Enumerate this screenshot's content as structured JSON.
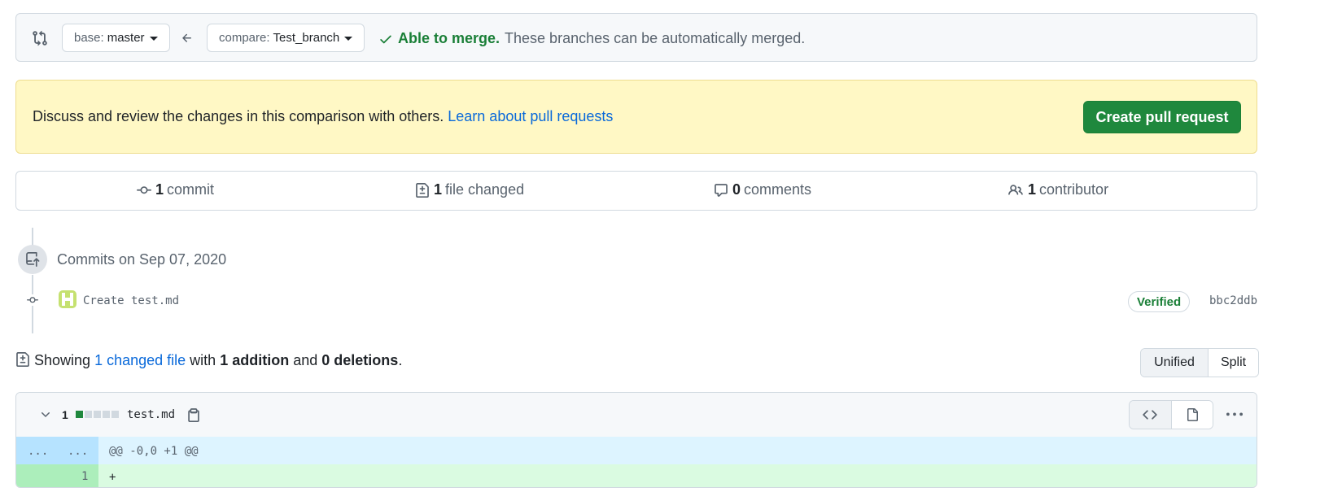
{
  "compare": {
    "base_prefix": "base:",
    "base_branch": "master",
    "compare_prefix": "compare:",
    "compare_branch": "Test_branch",
    "merge_ok": "Able to merge.",
    "merge_message": "These branches can be automatically merged."
  },
  "flash": {
    "text": "Discuss and review the changes in this comparison with others.",
    "link": "Learn about pull requests",
    "button": "Create pull request"
  },
  "summary": {
    "commits_count": "1",
    "commits_label": "commit",
    "files_count": "1",
    "files_label": "file changed",
    "comments_count": "0",
    "comments_label": "comments",
    "contributors_count": "1",
    "contributors_label": "contributor"
  },
  "commits": {
    "heading": "Commits on Sep 07, 2020",
    "items": [
      {
        "message": "Create test.md",
        "verified": "Verified",
        "sha": "bbc2ddb"
      }
    ]
  },
  "diff": {
    "showing": "Showing",
    "changed_files": "1 changed file",
    "with": "with",
    "additions": "1 addition",
    "and": "and",
    "deletions": "0 deletions",
    "period": ".",
    "view_unified": "Unified",
    "view_split": "Split"
  },
  "file": {
    "changes": "1",
    "name": "test.md",
    "hunk_left": "...",
    "hunk_right": "...",
    "hunk_header": "@@ -0,0 +1 @@",
    "added_line_number": "1",
    "added_line": "+"
  },
  "icons": {
    "compare": "git-compare-icon",
    "arrow": "arrow-left-icon",
    "check": "check-icon",
    "commit": "git-commit-icon",
    "file_diff": "file-diff-icon",
    "comment": "comment-icon",
    "people": "people-icon",
    "repo_push": "repo-push-icon",
    "chevron": "chevron-down-icon",
    "copy": "copy-icon",
    "code": "code-icon",
    "file": "file-icon",
    "kebab": "kebab-horizontal-icon"
  },
  "colors": {
    "success": "#1a7f37",
    "button_green": "#1f883d",
    "link": "#0969da",
    "flash_bg": "#fff8c5",
    "hunk_bg": "#ddf4ff",
    "addition_bg": "#dafbe1"
  }
}
